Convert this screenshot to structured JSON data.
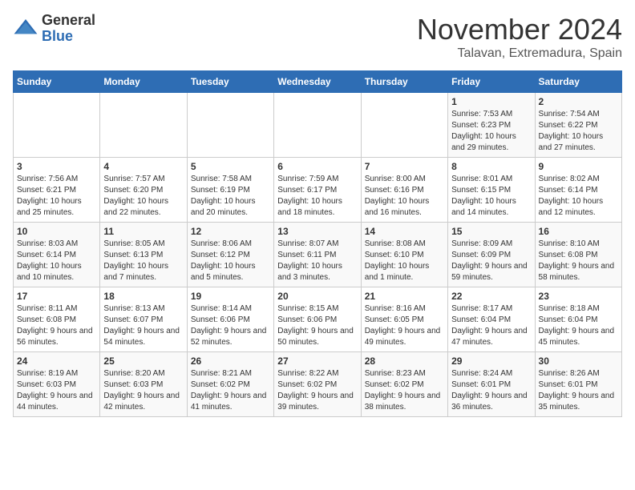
{
  "header": {
    "logo_general": "General",
    "logo_blue": "Blue",
    "month_title": "November 2024",
    "location": "Talavan, Extremadura, Spain"
  },
  "days_of_week": [
    "Sunday",
    "Monday",
    "Tuesday",
    "Wednesday",
    "Thursday",
    "Friday",
    "Saturday"
  ],
  "weeks": [
    [
      {
        "day": "",
        "info": ""
      },
      {
        "day": "",
        "info": ""
      },
      {
        "day": "",
        "info": ""
      },
      {
        "day": "",
        "info": ""
      },
      {
        "day": "",
        "info": ""
      },
      {
        "day": "1",
        "info": "Sunrise: 7:53 AM\nSunset: 6:23 PM\nDaylight: 10 hours and 29 minutes."
      },
      {
        "day": "2",
        "info": "Sunrise: 7:54 AM\nSunset: 6:22 PM\nDaylight: 10 hours and 27 minutes."
      }
    ],
    [
      {
        "day": "3",
        "info": "Sunrise: 7:56 AM\nSunset: 6:21 PM\nDaylight: 10 hours and 25 minutes."
      },
      {
        "day": "4",
        "info": "Sunrise: 7:57 AM\nSunset: 6:20 PM\nDaylight: 10 hours and 22 minutes."
      },
      {
        "day": "5",
        "info": "Sunrise: 7:58 AM\nSunset: 6:19 PM\nDaylight: 10 hours and 20 minutes."
      },
      {
        "day": "6",
        "info": "Sunrise: 7:59 AM\nSunset: 6:17 PM\nDaylight: 10 hours and 18 minutes."
      },
      {
        "day": "7",
        "info": "Sunrise: 8:00 AM\nSunset: 6:16 PM\nDaylight: 10 hours and 16 minutes."
      },
      {
        "day": "8",
        "info": "Sunrise: 8:01 AM\nSunset: 6:15 PM\nDaylight: 10 hours and 14 minutes."
      },
      {
        "day": "9",
        "info": "Sunrise: 8:02 AM\nSunset: 6:14 PM\nDaylight: 10 hours and 12 minutes."
      }
    ],
    [
      {
        "day": "10",
        "info": "Sunrise: 8:03 AM\nSunset: 6:14 PM\nDaylight: 10 hours and 10 minutes."
      },
      {
        "day": "11",
        "info": "Sunrise: 8:05 AM\nSunset: 6:13 PM\nDaylight: 10 hours and 7 minutes."
      },
      {
        "day": "12",
        "info": "Sunrise: 8:06 AM\nSunset: 6:12 PM\nDaylight: 10 hours and 5 minutes."
      },
      {
        "day": "13",
        "info": "Sunrise: 8:07 AM\nSunset: 6:11 PM\nDaylight: 10 hours and 3 minutes."
      },
      {
        "day": "14",
        "info": "Sunrise: 8:08 AM\nSunset: 6:10 PM\nDaylight: 10 hours and 1 minute."
      },
      {
        "day": "15",
        "info": "Sunrise: 8:09 AM\nSunset: 6:09 PM\nDaylight: 9 hours and 59 minutes."
      },
      {
        "day": "16",
        "info": "Sunrise: 8:10 AM\nSunset: 6:08 PM\nDaylight: 9 hours and 58 minutes."
      }
    ],
    [
      {
        "day": "17",
        "info": "Sunrise: 8:11 AM\nSunset: 6:08 PM\nDaylight: 9 hours and 56 minutes."
      },
      {
        "day": "18",
        "info": "Sunrise: 8:13 AM\nSunset: 6:07 PM\nDaylight: 9 hours and 54 minutes."
      },
      {
        "day": "19",
        "info": "Sunrise: 8:14 AM\nSunset: 6:06 PM\nDaylight: 9 hours and 52 minutes."
      },
      {
        "day": "20",
        "info": "Sunrise: 8:15 AM\nSunset: 6:06 PM\nDaylight: 9 hours and 50 minutes."
      },
      {
        "day": "21",
        "info": "Sunrise: 8:16 AM\nSunset: 6:05 PM\nDaylight: 9 hours and 49 minutes."
      },
      {
        "day": "22",
        "info": "Sunrise: 8:17 AM\nSunset: 6:04 PM\nDaylight: 9 hours and 47 minutes."
      },
      {
        "day": "23",
        "info": "Sunrise: 8:18 AM\nSunset: 6:04 PM\nDaylight: 9 hours and 45 minutes."
      }
    ],
    [
      {
        "day": "24",
        "info": "Sunrise: 8:19 AM\nSunset: 6:03 PM\nDaylight: 9 hours and 44 minutes."
      },
      {
        "day": "25",
        "info": "Sunrise: 8:20 AM\nSunset: 6:03 PM\nDaylight: 9 hours and 42 minutes."
      },
      {
        "day": "26",
        "info": "Sunrise: 8:21 AM\nSunset: 6:02 PM\nDaylight: 9 hours and 41 minutes."
      },
      {
        "day": "27",
        "info": "Sunrise: 8:22 AM\nSunset: 6:02 PM\nDaylight: 9 hours and 39 minutes."
      },
      {
        "day": "28",
        "info": "Sunrise: 8:23 AM\nSunset: 6:02 PM\nDaylight: 9 hours and 38 minutes."
      },
      {
        "day": "29",
        "info": "Sunrise: 8:24 AM\nSunset: 6:01 PM\nDaylight: 9 hours and 36 minutes."
      },
      {
        "day": "30",
        "info": "Sunrise: 8:26 AM\nSunset: 6:01 PM\nDaylight: 9 hours and 35 minutes."
      }
    ]
  ]
}
